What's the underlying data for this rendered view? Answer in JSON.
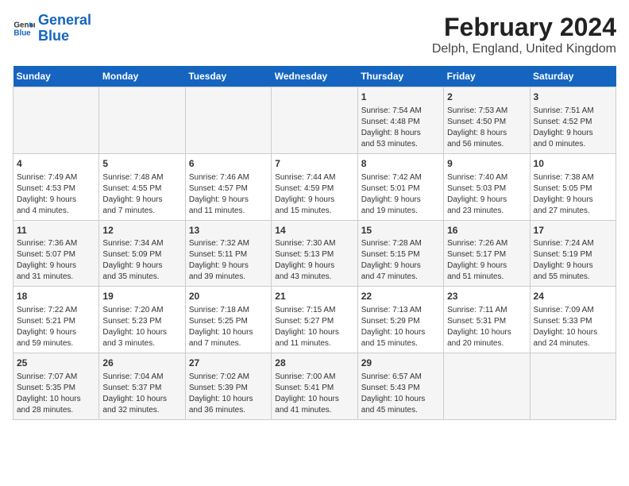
{
  "logo": {
    "line1": "General",
    "line2": "Blue"
  },
  "title": "February 2024",
  "location": "Delph, England, United Kingdom",
  "headers": [
    "Sunday",
    "Monday",
    "Tuesday",
    "Wednesday",
    "Thursday",
    "Friday",
    "Saturday"
  ],
  "weeks": [
    [
      {
        "day": "",
        "info": ""
      },
      {
        "day": "",
        "info": ""
      },
      {
        "day": "",
        "info": ""
      },
      {
        "day": "",
        "info": ""
      },
      {
        "day": "1",
        "info": "Sunrise: 7:54 AM\nSunset: 4:48 PM\nDaylight: 8 hours\nand 53 minutes."
      },
      {
        "day": "2",
        "info": "Sunrise: 7:53 AM\nSunset: 4:50 PM\nDaylight: 8 hours\nand 56 minutes."
      },
      {
        "day": "3",
        "info": "Sunrise: 7:51 AM\nSunset: 4:52 PM\nDaylight: 9 hours\nand 0 minutes."
      }
    ],
    [
      {
        "day": "4",
        "info": "Sunrise: 7:49 AM\nSunset: 4:53 PM\nDaylight: 9 hours\nand 4 minutes."
      },
      {
        "day": "5",
        "info": "Sunrise: 7:48 AM\nSunset: 4:55 PM\nDaylight: 9 hours\nand 7 minutes."
      },
      {
        "day": "6",
        "info": "Sunrise: 7:46 AM\nSunset: 4:57 PM\nDaylight: 9 hours\nand 11 minutes."
      },
      {
        "day": "7",
        "info": "Sunrise: 7:44 AM\nSunset: 4:59 PM\nDaylight: 9 hours\nand 15 minutes."
      },
      {
        "day": "8",
        "info": "Sunrise: 7:42 AM\nSunset: 5:01 PM\nDaylight: 9 hours\nand 19 minutes."
      },
      {
        "day": "9",
        "info": "Sunrise: 7:40 AM\nSunset: 5:03 PM\nDaylight: 9 hours\nand 23 minutes."
      },
      {
        "day": "10",
        "info": "Sunrise: 7:38 AM\nSunset: 5:05 PM\nDaylight: 9 hours\nand 27 minutes."
      }
    ],
    [
      {
        "day": "11",
        "info": "Sunrise: 7:36 AM\nSunset: 5:07 PM\nDaylight: 9 hours\nand 31 minutes."
      },
      {
        "day": "12",
        "info": "Sunrise: 7:34 AM\nSunset: 5:09 PM\nDaylight: 9 hours\nand 35 minutes."
      },
      {
        "day": "13",
        "info": "Sunrise: 7:32 AM\nSunset: 5:11 PM\nDaylight: 9 hours\nand 39 minutes."
      },
      {
        "day": "14",
        "info": "Sunrise: 7:30 AM\nSunset: 5:13 PM\nDaylight: 9 hours\nand 43 minutes."
      },
      {
        "day": "15",
        "info": "Sunrise: 7:28 AM\nSunset: 5:15 PM\nDaylight: 9 hours\nand 47 minutes."
      },
      {
        "day": "16",
        "info": "Sunrise: 7:26 AM\nSunset: 5:17 PM\nDaylight: 9 hours\nand 51 minutes."
      },
      {
        "day": "17",
        "info": "Sunrise: 7:24 AM\nSunset: 5:19 PM\nDaylight: 9 hours\nand 55 minutes."
      }
    ],
    [
      {
        "day": "18",
        "info": "Sunrise: 7:22 AM\nSunset: 5:21 PM\nDaylight: 9 hours\nand 59 minutes."
      },
      {
        "day": "19",
        "info": "Sunrise: 7:20 AM\nSunset: 5:23 PM\nDaylight: 10 hours\nand 3 minutes."
      },
      {
        "day": "20",
        "info": "Sunrise: 7:18 AM\nSunset: 5:25 PM\nDaylight: 10 hours\nand 7 minutes."
      },
      {
        "day": "21",
        "info": "Sunrise: 7:15 AM\nSunset: 5:27 PM\nDaylight: 10 hours\nand 11 minutes."
      },
      {
        "day": "22",
        "info": "Sunrise: 7:13 AM\nSunset: 5:29 PM\nDaylight: 10 hours\nand 15 minutes."
      },
      {
        "day": "23",
        "info": "Sunrise: 7:11 AM\nSunset: 5:31 PM\nDaylight: 10 hours\nand 20 minutes."
      },
      {
        "day": "24",
        "info": "Sunrise: 7:09 AM\nSunset: 5:33 PM\nDaylight: 10 hours\nand 24 minutes."
      }
    ],
    [
      {
        "day": "25",
        "info": "Sunrise: 7:07 AM\nSunset: 5:35 PM\nDaylight: 10 hours\nand 28 minutes."
      },
      {
        "day": "26",
        "info": "Sunrise: 7:04 AM\nSunset: 5:37 PM\nDaylight: 10 hours\nand 32 minutes."
      },
      {
        "day": "27",
        "info": "Sunrise: 7:02 AM\nSunset: 5:39 PM\nDaylight: 10 hours\nand 36 minutes."
      },
      {
        "day": "28",
        "info": "Sunrise: 7:00 AM\nSunset: 5:41 PM\nDaylight: 10 hours\nand 41 minutes."
      },
      {
        "day": "29",
        "info": "Sunrise: 6:57 AM\nSunset: 5:43 PM\nDaylight: 10 hours\nand 45 minutes."
      },
      {
        "day": "",
        "info": ""
      },
      {
        "day": "",
        "info": ""
      }
    ]
  ]
}
